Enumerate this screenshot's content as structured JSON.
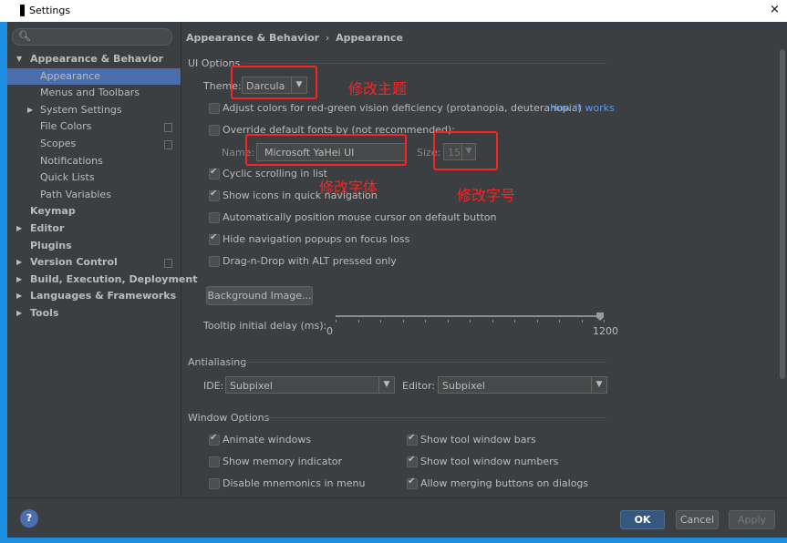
{
  "window": {
    "title": "Settings",
    "close_glyph": "×"
  },
  "search": {
    "placeholder": ""
  },
  "sidebar": {
    "items": [
      {
        "label": "Appearance & Behavior",
        "level": 0,
        "bold": true,
        "arrow": "▼"
      },
      {
        "label": "Appearance",
        "level": 1,
        "selected": true
      },
      {
        "label": "Menus and Toolbars",
        "level": 1
      },
      {
        "label": "System Settings",
        "level": 1,
        "arrow": "▶"
      },
      {
        "label": "File Colors",
        "level": 1,
        "project_icon": true
      },
      {
        "label": "Scopes",
        "level": 1,
        "project_icon": true
      },
      {
        "label": "Notifications",
        "level": 1
      },
      {
        "label": "Quick Lists",
        "level": 1
      },
      {
        "label": "Path Variables",
        "level": 1
      },
      {
        "label": "Keymap",
        "level": 0,
        "bold": true
      },
      {
        "label": "Editor",
        "level": 0,
        "bold": true,
        "arrow": "▶"
      },
      {
        "label": "Plugins",
        "level": 0,
        "bold": true
      },
      {
        "label": "Version Control",
        "level": 0,
        "bold": true,
        "arrow": "▶",
        "project_icon": true
      },
      {
        "label": "Build, Execution, Deployment",
        "level": 0,
        "bold": true,
        "arrow": "▶"
      },
      {
        "label": "Languages & Frameworks",
        "level": 0,
        "bold": true,
        "arrow": "▶"
      },
      {
        "label": "Tools",
        "level": 0,
        "bold": true,
        "arrow": "▶"
      }
    ]
  },
  "breadcrumb": {
    "parent": "Appearance & Behavior",
    "separator": "›",
    "current": "Appearance"
  },
  "ui_options": {
    "section": "UI Options",
    "theme_label": "Theme:",
    "theme_value": "Darcula",
    "colorblind_label": "Adjust colors for red-green vision deficiency (protanopia, deuteranopia)",
    "how_it_works": "How it works",
    "override_fonts_label": "Override default fonts by (not recommended):",
    "name_label": "Name:",
    "font_name": "Microsoft YaHei UI",
    "size_label": "Size:",
    "font_size": "15",
    "cyclic_label": "Cyclic scrolling in list",
    "show_icons_label": "Show icons in quick navigation",
    "auto_cursor_label": "Automatically position mouse cursor on default button",
    "hide_nav_label": "Hide navigation popups on focus loss",
    "dnd_label": "Drag-n-Drop with ALT pressed only",
    "background_button": "Background Image...",
    "tooltip_label": "Tooltip initial delay (ms):",
    "slider_min": "0",
    "slider_max": "1200",
    "slider_value_fraction": 1.0
  },
  "checkbox_states": {
    "colorblind": false,
    "override_fonts": false,
    "cyclic": true,
    "show_icons": true,
    "auto_cursor": false,
    "hide_nav": true,
    "dnd": false,
    "animate": true,
    "memory": false,
    "mnemonics": false,
    "tool_bars": true,
    "tool_numbers": true,
    "merging": true
  },
  "antialiasing": {
    "section": "Antialiasing",
    "ide_label": "IDE:",
    "ide_value": "Subpixel",
    "editor_label": "Editor:",
    "editor_value": "Subpixel"
  },
  "window_options": {
    "section": "Window Options",
    "animate": "Animate windows",
    "memory": "Show memory indicator",
    "mnemonics": "Disable mnemonics in menu",
    "tool_bars": "Show tool window bars",
    "tool_numbers": "Show tool window numbers",
    "merging": "Allow merging buttons on dialogs"
  },
  "annotations": {
    "theme": "修改主题",
    "font": "修改字体",
    "size": "修改字号",
    "color": "#ff2222"
  },
  "footer": {
    "help": "?",
    "ok": "OK",
    "cancel": "Cancel",
    "apply": "Apply"
  }
}
